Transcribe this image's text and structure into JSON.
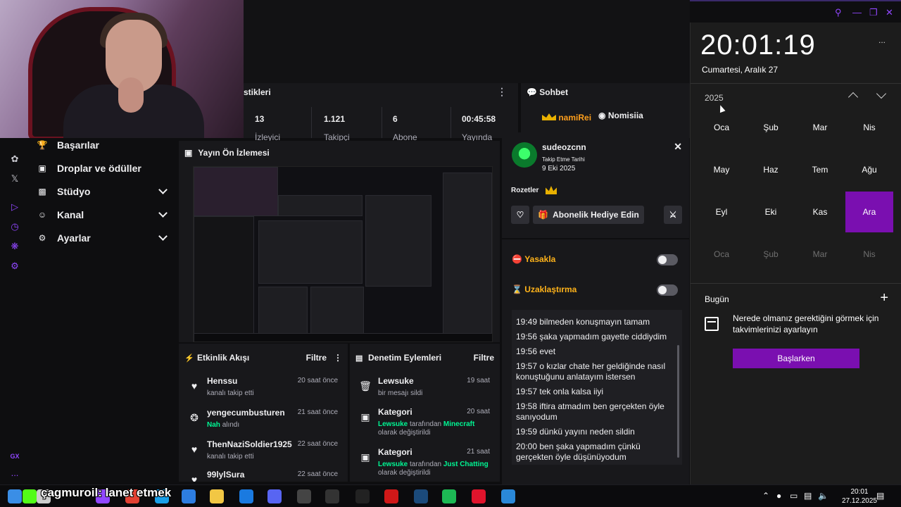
{
  "stats": {
    "title": "stikleri",
    "items": [
      {
        "value": "13",
        "label": "İzleyici"
      },
      {
        "value": "1.121",
        "label": "Takipçi"
      },
      {
        "value": "6",
        "label": "Abone"
      },
      {
        "value": "00:45:58",
        "label": "Yayında"
      }
    ]
  },
  "chat": {
    "title": "Sohbet",
    "user1": "namiRei",
    "user2": "Nomisiia"
  },
  "sidenav": {
    "items": [
      {
        "icon": "trophy-icon",
        "label": "Başarılar"
      },
      {
        "icon": "drops-icon",
        "label": "Droplar ve ödüller"
      },
      {
        "icon": "studio-icon",
        "label": "Stüdyo"
      },
      {
        "icon": "channel-icon",
        "label": "Kanal"
      },
      {
        "icon": "gear-icon",
        "label": "Ayarlar"
      }
    ]
  },
  "rail": {
    "gx": "GX",
    "more": "..."
  },
  "preview": {
    "title": "Yayın Ön İzlemesi"
  },
  "feed": {
    "title": "Etkinlik Akışı",
    "filter": "Filtre",
    "items": [
      {
        "icon": "heart-icon",
        "name": "Henssu",
        "desc": "kanalı takip etti",
        "time": "20 saat önce"
      },
      {
        "icon": "points-icon",
        "name": "yengecumbusturen",
        "desc_green": "Nah",
        "desc": "alındı",
        "time": "21 saat önce"
      },
      {
        "icon": "heart-icon",
        "name": "ThenNaziSoldier1925",
        "desc": "kanalı takip etti",
        "time": "22 saat önce"
      },
      {
        "icon": "heart-icon",
        "name": "99lylSura",
        "desc": "",
        "time": "22 saat önce"
      }
    ]
  },
  "mod": {
    "title": "Denetim Eylemleri",
    "filter": "Filtre",
    "items": [
      {
        "icon": "trash-icon",
        "name": "Lewsuke",
        "desc": "bir mesajı sildi",
        "time": "19 saat"
      },
      {
        "icon": "category-icon",
        "name": "Kategori",
        "user": "Lewsuke",
        "mid": "tarafından",
        "game": "Minecraft",
        "tail": "olarak değiştirildi",
        "time": "20 saat"
      },
      {
        "icon": "category-icon",
        "name": "Kategori",
        "user": "Lewsuke",
        "mid": "tarafından",
        "game": "Just Chatting",
        "tail": "olarak değiştirildi",
        "time": "21 saat"
      }
    ]
  },
  "usercard": {
    "username": "sudeozcnn",
    "follow_label": "Takip Etme Tarihi",
    "follow_date": "9 Eki 2025",
    "badges_label": "Rozetler",
    "gift_button": "Abonelik Hediye Edin"
  },
  "moderation": {
    "ban_label": "Yasakla",
    "timeout_label": "Uzaklaştırma",
    "messages": [
      "19:49 bilmeden konuşmayın tamam",
      "19:56 şaka yapmadım gayette ciddiydim",
      "19:56 evet",
      "19:57 o kızlar chate her geldiğinde nasıl konuştuğunu anlatayım istersen",
      "19:57 tek onla kalsa iiyi",
      "19:58 iftira atmadım ben gerçekten öyle sanıyodum",
      "19:59 dünkü yayını neden sildin",
      "20:00 ben şaka yapmadım çünkü gerçekten öyle düşünüyodum"
    ]
  },
  "calendar": {
    "time": "20:01:19",
    "date": "Cumartesi, Aralık 27",
    "more": "...",
    "year": "2025",
    "months": [
      "Oca",
      "Şub",
      "Mar",
      "Nis",
      "May",
      "Haz",
      "Tem",
      "Ağu",
      "Eyl",
      "Eki",
      "Kas",
      "Ara"
    ],
    "next_months": [
      "Oca",
      "Şub",
      "Mar",
      "Nis"
    ],
    "selected": "Ara",
    "today": "Bugün",
    "hint": "Nerede olmanız gerektiğini görmek için takvimlerinizi ayarlayın",
    "start_button": "Başlarken"
  },
  "taskbar": {
    "overlay": "çagmuroil: lanet etmek",
    "clock_time": "20:01",
    "clock_date": "27.12.2025",
    "apps": [
      {
        "icon": "windows-start-icon",
        "color": "#3a8ee6"
      },
      {
        "icon": "kick-icon",
        "color": "#53fc18"
      },
      {
        "icon": "search-icon",
        "color": "#cccccc"
      },
      {
        "icon": "task-view-icon",
        "color": "#9147ff"
      },
      {
        "icon": "chrome-icon",
        "color": "#e34133"
      },
      {
        "icon": "edge-icon",
        "color": "#1aa0e8"
      },
      {
        "icon": "app-icon",
        "color": "#2d7de0"
      },
      {
        "icon": "file-explorer-icon",
        "color": "#f2c744"
      },
      {
        "icon": "mail-icon",
        "color": "#1a7ae0"
      },
      {
        "icon": "discord-icon",
        "color": "#5865f2"
      },
      {
        "icon": "obs-icon",
        "color": "#444444"
      },
      {
        "icon": "app-g-icon",
        "color": "#333333"
      },
      {
        "icon": "epic-games-icon",
        "color": "#222222"
      },
      {
        "icon": "app-red-icon",
        "color": "#d01818"
      },
      {
        "icon": "steam-icon",
        "color": "#1b4a7a"
      },
      {
        "icon": "spotify-icon",
        "color": "#1db954"
      },
      {
        "icon": "opera-icon",
        "color": "#e0142c"
      },
      {
        "icon": "app-blue-icon",
        "color": "#2a88d8"
      }
    ]
  },
  "colors": {
    "accent": "#9147ff",
    "calendar_selected": "#7a0fb0",
    "warning": "#ffb31a",
    "green": "#00f593"
  }
}
